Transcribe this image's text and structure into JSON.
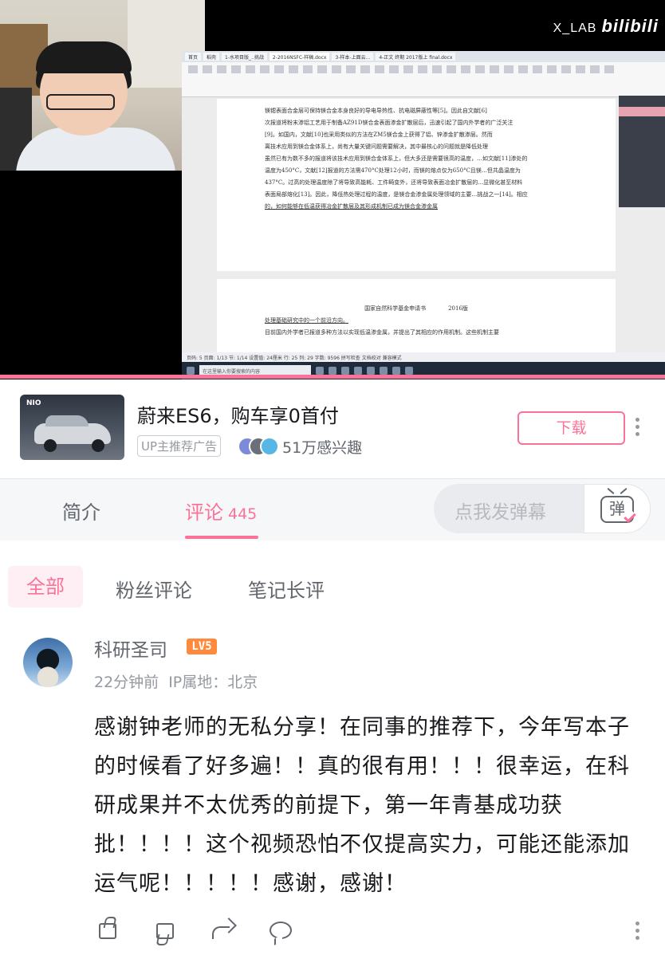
{
  "video": {
    "watermark_text": "X_LAB",
    "watermark_brand": "bilibili",
    "screen": {
      "tabs": [
        "首页",
        "稻壳",
        "1-水项目版_..挑战",
        "2-2016NSFC-样稿.docx",
        "3-样本-上面云...",
        "4-正文 终期 2017版上 final.docx"
      ],
      "doc_lines": [
        "镁锶表面合金层可保持镁合金本身良好的导电导热性、抗电磁屏蔽性等[5]。因此自文献[6]",
        "次报道将粉末渗铝工艺用于制备AZ91D镁合金表面渗金扩散层后，迅速引起了国内外学者的广泛关注",
        "[9]。如国内，文献[10]也采用类似的方法在ZM5镁合金上获得了铝、锌渗金扩散渗层。然而",
        "离技术应用到镁合金体系上，尚有大量关键问题需要解决，其中最核心的问题就是降低处理",
        "虽然已有为数不多的报道将该技术应用到镁合金体系上，但大多还是需要很高的温度，…如文献[11]渗处的",
        "温度为450°C，文献[12]报道的方法需470°C处理12小时，而镁的熔点仅为650°C且镁…但共晶温度为",
        "437°C。过高的处理温度除了将导致高能耗、工件畸变外，还将导致表面冶金扩散层的…显微化甚至材料",
        "表面局部熔化[13]。因此，降低热处理过程的温度，是镁合金渗金属处理领域的主要…挑战之一[14]。相应",
        "的，如何能够在低温获得冶金扩散层及其形成机制已成为镁合金渗金属"
      ],
      "page2_header": "国家自然科学基金申请书　　　　2016版",
      "page2_lines": [
        "处理基础研究中的一个前沿方向。",
        "目前国内外学者已报道多种方法以实现低温渗金属，并提出了其相应的作用机制。这些机制主要"
      ],
      "status_text": "页码: 5  页面: 1/13  节: 1/14  设置值: 24厘米  行: 25  列: 29  字数: 9596  拼写检查  文档校对  兼容模式",
      "taskbar_search": "在这里输入你要搜索的内容"
    }
  },
  "ad": {
    "brand_logo": "NIO",
    "title": "蔚来ES6，购车享0首付",
    "tag": "UP主推荐广告",
    "interest": "51万感兴趣",
    "download_label": "下载",
    "avatar_colors": [
      "#7b8bd8",
      "#6a6f78",
      "#58b6e6"
    ]
  },
  "tabs": {
    "intro_label": "简介",
    "comments_label": "评论",
    "comments_count": "445",
    "danmaku_placeholder": "点我发弹幕",
    "danmaku_icon_label": "弹"
  },
  "filters": {
    "all": "全部",
    "fans": "粉丝评论",
    "notes": "笔记长评"
  },
  "comment": {
    "username": "科研圣司",
    "level": "LV5",
    "time": "22分钟前",
    "ip": "IP属地：北京",
    "content": "感谢钟老师的无私分享！在同事的推荐下，今年写本子的时候看了好多遍！！真的很有用！！！很幸运，在科研成果并不太优秀的前提下，第一年青基成功获批！！！！这个视频恐怕不仅提高实力，可能还能添加运气呢！！！！！感谢，感谢！"
  },
  "colors": {
    "accent": "#fb7299",
    "level_badge": "#ff8a3d",
    "text_secondary": "#61666d",
    "text_muted": "#9499a0"
  },
  "icons": [
    "like-icon",
    "dislike-icon",
    "share-icon",
    "reply-icon",
    "more-icon",
    "danmaku-tv-icon"
  ]
}
